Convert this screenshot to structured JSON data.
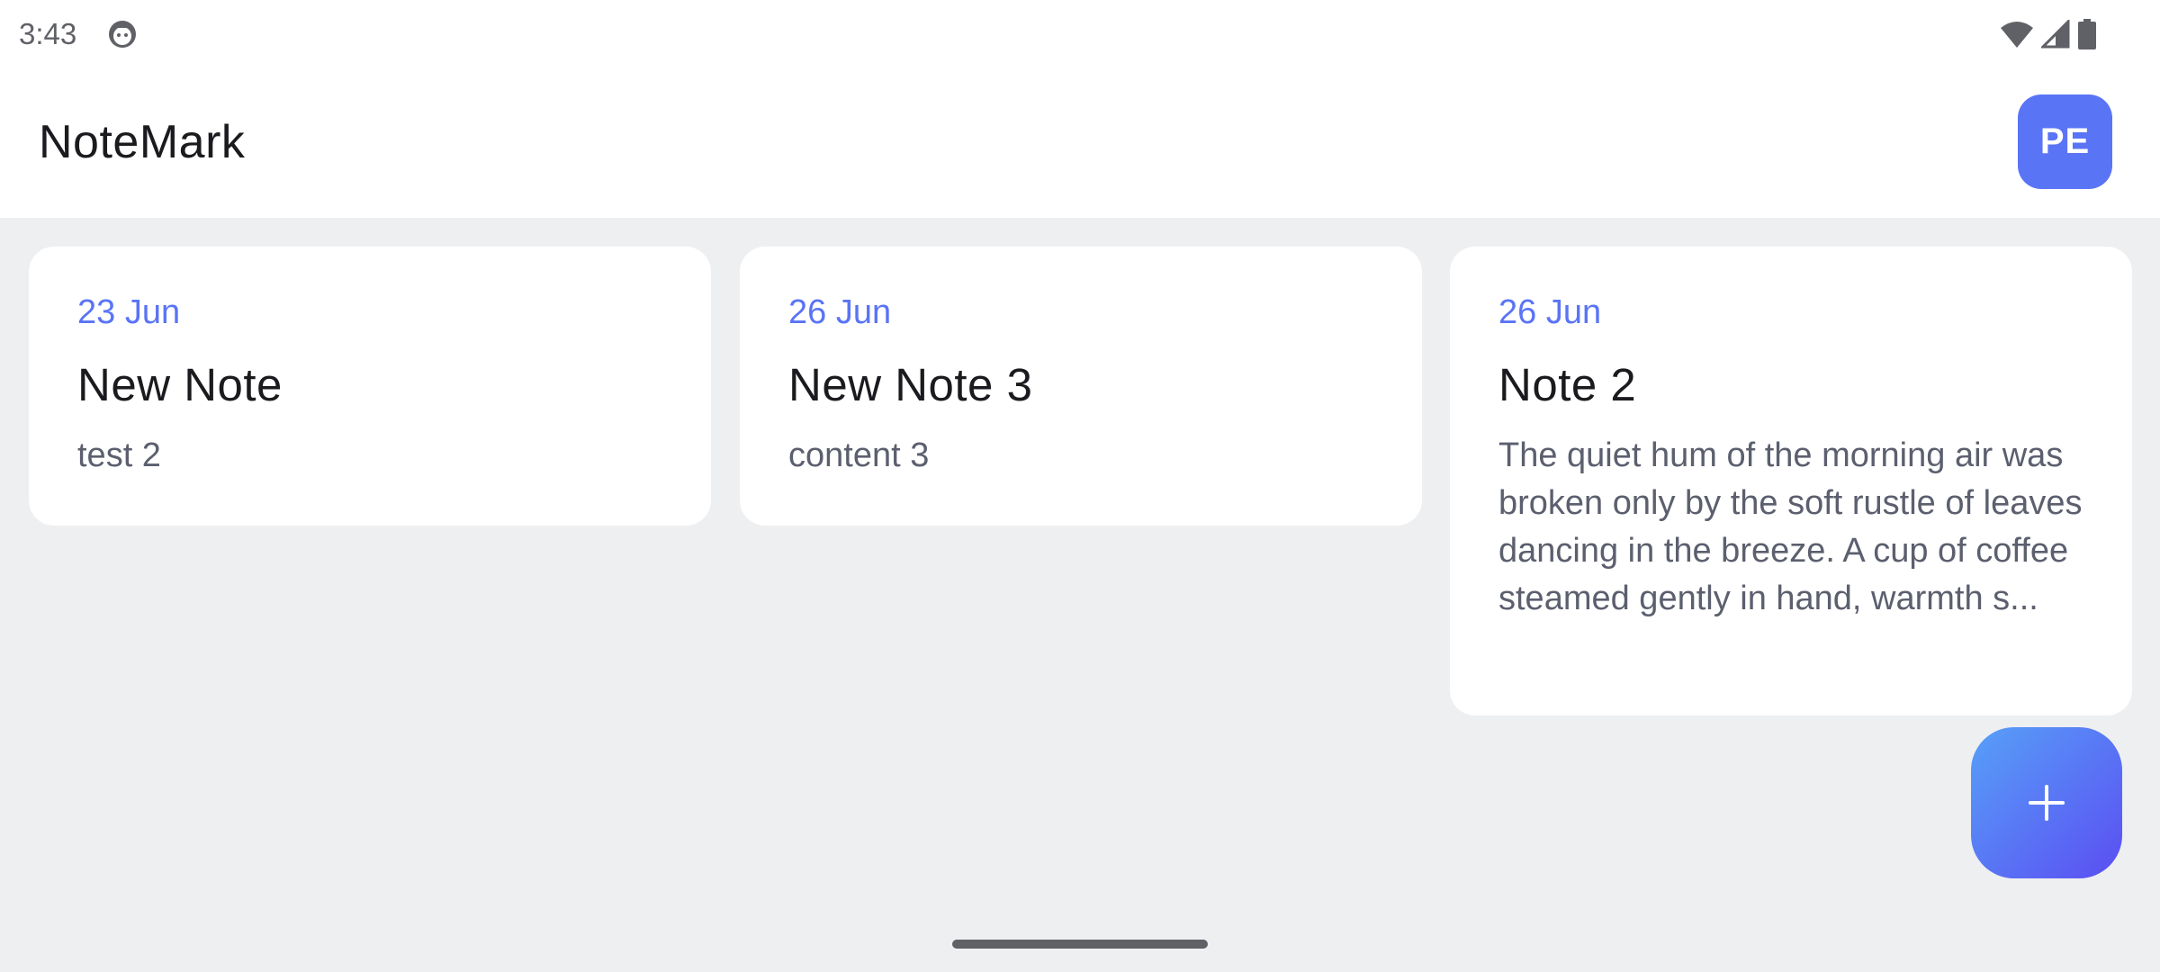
{
  "status_bar": {
    "time": "3:43",
    "app_icon": "android-face-icon",
    "icons": [
      "wifi-icon",
      "cellular-signal-icon",
      "battery-icon"
    ]
  },
  "app_bar": {
    "title": "NoteMark",
    "avatar_initials": "PE"
  },
  "notes": [
    {
      "date": "23 Jun",
      "title": "New Note",
      "body": "test 2"
    },
    {
      "date": "26 Jun",
      "title": "New Note 3",
      "body": "content 3"
    },
    {
      "date": "26 Jun",
      "title": "Note 2",
      "body": "The quiet hum of the morning air was broken only by the soft rustle of leaves dancing in the breeze. A cup of coffee steamed gently in hand, warmth s..."
    }
  ],
  "fab": {
    "icon": "plus-icon"
  },
  "colors": {
    "accent": "#5A74F6",
    "background": "#EEEFF1",
    "card": "#FFFFFF",
    "fab_gradient_start": "#58A0F8",
    "fab_gradient_end": "#5A4EF2"
  }
}
